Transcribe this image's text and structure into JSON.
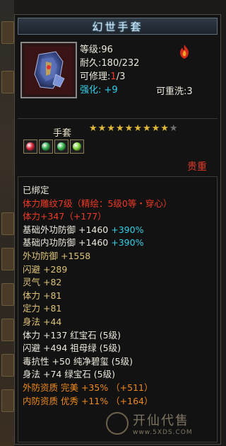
{
  "item": {
    "name": "幻世手套",
    "level_label": "等级",
    "level": ":96",
    "durability_label": "耐久",
    "durability": ":180/232",
    "repairable_label": "可修理",
    "repair_sep": ":",
    "repair_current": "1",
    "repair_total": "/3",
    "rewash_label": "可重洗",
    "rewash_value": ":3",
    "enhance_label": "强化",
    "enhance_value": ": +9",
    "category": "手套",
    "stars_total": 10,
    "stars_filled": 9,
    "rarity": "贵重",
    "gems": [
      {
        "color": "#d8263a",
        "name": "red-gem-icon"
      },
      {
        "color": "#2fa64a",
        "name": "green-gem-icon"
      },
      {
        "color": "#36b54b",
        "name": "green-gem-icon"
      },
      {
        "color": "#7fd23a",
        "name": "lime-gem-icon"
      }
    ]
  },
  "attributes": {
    "bound": "已绑定",
    "craft": "体力雕纹7级（精绘：5级0等・穿心）",
    "stamina": "体力+347（+177）",
    "base_ext_def": "基础外功防御 +1460 ",
    "base_ext_def_pct": "+390%",
    "base_int_def": "基础内功防御 +1460 ",
    "base_int_def_pct": "+390%",
    "ext_def": "外功防御 +1558",
    "dodge": "闪避  +289",
    "spirit": "灵气  +82",
    "stamina2": "体力  +81",
    "focus": "定力  +81",
    "agility": "身法  +44",
    "gem1": "体力 +137 红宝石 (5级)",
    "gem2": "闪避 +494 祖母绿 (5级)",
    "gem3": "毒抗性 +50 纯净碧玺 (5级)",
    "gem4": "身法 +74 绿宝石 (5级)",
    "ext_qual": "外防资质   完美 +35% （+511）",
    "int_qual": "内防资质   优秀 +11% （+164）"
  },
  "watermark": {
    "text": "开仙代售",
    "url": "www.5XDS.COM"
  }
}
